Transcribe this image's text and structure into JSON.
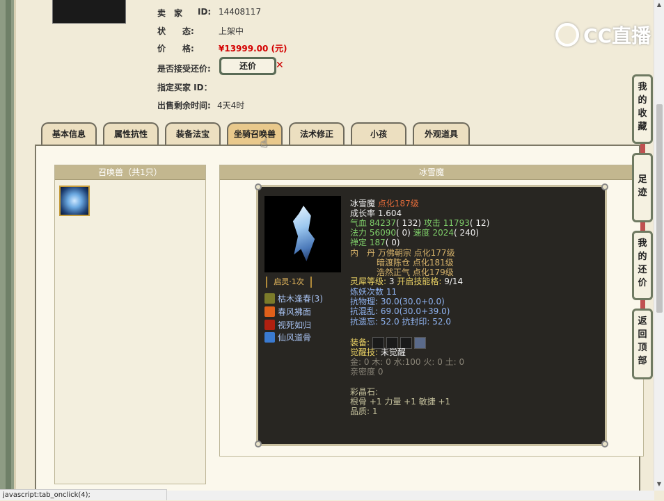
{
  "seller": {
    "label_seller": "卖　家",
    "id_label": "ID:",
    "id_value": "14408117",
    "label_status": "状　　态:",
    "status_value": "上架中",
    "label_price": "价　　格:",
    "price_value": "¥13999.00 (元)",
    "label_counter": "是否接受还价:",
    "counter_button": "还价",
    "label_buyer": "指定买家 ID：",
    "label_time": "出售剩余时间:",
    "time_value": "4天4时"
  },
  "logo": {
    "text": "CC直播"
  },
  "tabs": [
    {
      "label": "基本信息"
    },
    {
      "label": "属性抗性"
    },
    {
      "label": "装备法宝"
    },
    {
      "label": "坐骑召唤兽",
      "active": true
    },
    {
      "label": "法术修正"
    },
    {
      "label": "小孩"
    },
    {
      "label": "外观道具"
    }
  ],
  "pet_list": {
    "header": "召唤兽（共1只）"
  },
  "detail": {
    "header": "冰雪魔",
    "spirit": "启灵·1次",
    "skills": [
      {
        "name": "枯木逢春(3)",
        "icon": "tree-icon",
        "color": "#7b7b2a"
      },
      {
        "name": "春风拂面",
        "icon": "flame-icon",
        "color": "#e0601a"
      },
      {
        "name": "视死如归",
        "icon": "blade-icon",
        "color": "#b02010"
      },
      {
        "name": "仙风道骨",
        "icon": "wind-icon",
        "color": "#3a7ad0"
      }
    ],
    "name": "冰雪魔",
    "level": "点化187级",
    "growth": "成长率 1.604",
    "hp_label": "气血 84237",
    "hp_extra": "( 132)",
    "atk_label": "攻击 11793",
    "atk_extra": "( 12)",
    "mp_label": "法力 56090",
    "mp_extra": "( 0)",
    "spd_label": "速度 2024",
    "spd_extra": "( 240)",
    "zen_label": "禅定 187",
    "zen_extra": "( 0)",
    "neidan_label": "内　丹",
    "neidan1": "万佛朝宗 点化177级",
    "neidan2": "暗渡陈仓 点化181级",
    "neidan3": "浩然正气 点化179级",
    "soul_label": "灵犀等级:",
    "soul_value": "3",
    "skill_grid_label": "开启技能格:",
    "skill_grid_value": "9/14",
    "refine": "炼妖次数 11",
    "res_phys": "抗物理: 30.0(30.0+0.0)",
    "res_chaos": "抗混乱: 69.0(30.0+39.0)",
    "res_forget": "抗遗忘: 52.0 抗封印: 52.0",
    "equip_label": "装备:",
    "awaken_label": "觉醒技:",
    "awaken_value": "未觉醒",
    "elements": "金: 0 木: 0 水:100 火: 0 土: 0",
    "intimacy": "亲密度 0",
    "gem_title": "彩晶石:",
    "gem_attrs": "根骨 +1 力量 +1 敏捷 +1",
    "quality": "品质:  1"
  },
  "side": {
    "fav": "我的收藏",
    "trail": "足迹",
    "offers": "我的还价",
    "top": "返回顶部"
  },
  "statusbar": "javascript:tab_onclick(4);"
}
